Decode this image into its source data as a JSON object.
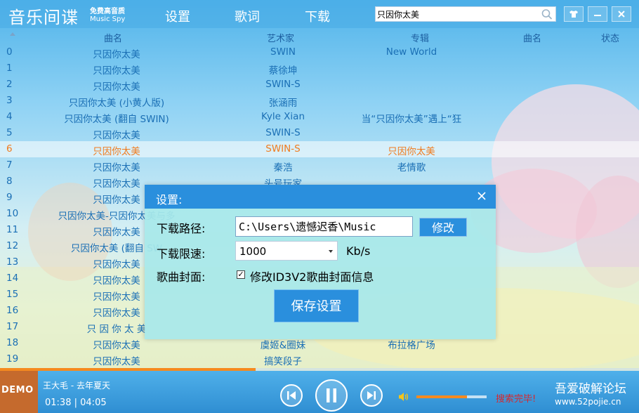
{
  "app": {
    "logo": "音乐间谍",
    "logo_sub1": "免费高音质",
    "logo_sub2": "Music Spy"
  },
  "menu": [
    "设置",
    "歌词",
    "下载"
  ],
  "search": {
    "value": "只因你太美"
  },
  "window_buttons": [
    "shirt-icon",
    "minimize-icon",
    "close-icon"
  ],
  "list": {
    "headers": {
      "name": "曲名",
      "artist": "艺术家",
      "album": "专辑",
      "name2": "曲名",
      "status": "状态"
    },
    "rows": [
      {
        "idx": "0",
        "name": "只因你太美",
        "artist": "SWIN",
        "album": "New World"
      },
      {
        "idx": "1",
        "name": "只因你太美",
        "artist": "蔡徐坤",
        "album": ""
      },
      {
        "idx": "2",
        "name": "只因你太美",
        "artist": "SWIN-S",
        "album": ""
      },
      {
        "idx": "3",
        "name": "只因你太美 (小黄人版)",
        "artist": "张涵雨",
        "album": ""
      },
      {
        "idx": "4",
        "name": "只因你太美 (翻自 SWIN)",
        "artist": "Kyle Xian",
        "album": "当“只因你太美”遇上“狂"
      },
      {
        "idx": "5",
        "name": "只因你太美",
        "artist": "SWIN-S",
        "album": ""
      },
      {
        "idx": "6",
        "name": "只因你太美",
        "artist": "SWIN-S",
        "album": "只因你太美"
      },
      {
        "idx": "7",
        "name": "只因你太美",
        "artist": "秦浩",
        "album": "老情歌"
      },
      {
        "idx": "8",
        "name": "只因你太美",
        "artist": "头号玩家",
        "album": ""
      },
      {
        "idx": "9",
        "name": "只因你太美",
        "artist": "",
        "album": ""
      },
      {
        "idx": "10",
        "name": "只因你太美-只因你太美与多",
        "artist": "",
        "album": ""
      },
      {
        "idx": "11",
        "name": "只因你太美",
        "artist": "",
        "album": ""
      },
      {
        "idx": "12",
        "name": "只因你太美 (翻自 SW",
        "artist": "",
        "album": ""
      },
      {
        "idx": "13",
        "name": "只因你太美",
        "artist": "",
        "album": ""
      },
      {
        "idx": "14",
        "name": "只因你太美",
        "artist": "",
        "album": ""
      },
      {
        "idx": "15",
        "name": "只因你太美",
        "artist": "",
        "album": ""
      },
      {
        "idx": "16",
        "name": "只因你太美",
        "artist": "",
        "album": ""
      },
      {
        "idx": "17",
        "name": "只 因 你 太 美",
        "artist": "",
        "album": ""
      },
      {
        "idx": "18",
        "name": "只因你太美",
        "artist": "虞姬&圈妹",
        "album": "布拉格广场"
      },
      {
        "idx": "19",
        "name": "只因你太美",
        "artist": "搞笑段子",
        "album": ""
      }
    ],
    "selected_index": 6
  },
  "dialog": {
    "title": "设置:",
    "path_label": "下载路径:",
    "path_value": "C:\\Users\\遗憾迟香\\Music",
    "modify_label": "修改",
    "speed_label": "下载限速:",
    "speed_value": "1000",
    "speed_unit": "Kb/s",
    "cover_label": "歌曲封面:",
    "cover_checked": true,
    "cover_text": "修改ID3V2歌曲封面信息",
    "save_label": "保存设置"
  },
  "player": {
    "cover_text": "DEMO",
    "title": "王大毛 - 去年夏天",
    "elapsed": "01:38",
    "separator": "|",
    "total": "04:05",
    "progress": 0.4,
    "volume": 0.72,
    "status": "搜索完毕!",
    "watermark": "吾爱破解论坛",
    "watermark_url": "www.52pojie.cn"
  },
  "colors": {
    "accent": "#2a8fdd",
    "highlight": "#f07b1e",
    "text": "#1a6fb5",
    "status": "#d8262c"
  }
}
